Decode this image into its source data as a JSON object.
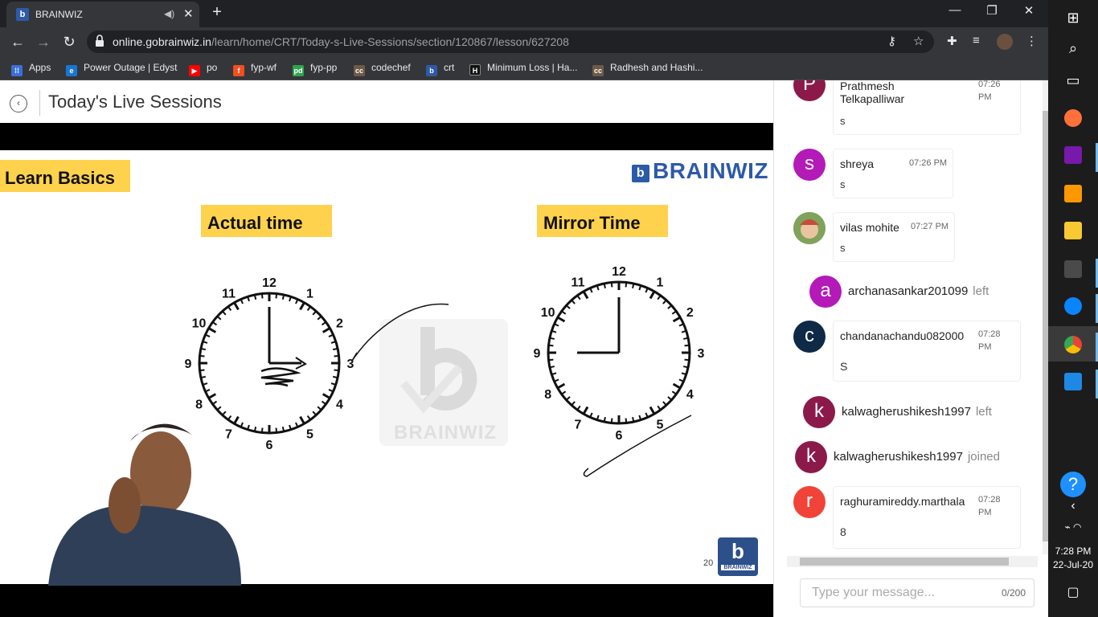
{
  "browser": {
    "tab_title": "BRAINWIZ",
    "url_domain": "online.gobrainwiz.in",
    "url_path": "/learn/home/CRT/Today-s-Live-Sessions/section/120867/lesson/627208",
    "bookmarks": [
      {
        "label": "Apps",
        "icon": "apps-grid-icon",
        "color": "#e8eaed"
      },
      {
        "label": "Power Outage | Edyst",
        "icon": "edyst-icon",
        "color": "#1976d2"
      },
      {
        "label": "po",
        "icon": "youtube-icon",
        "color": "#ff0000"
      },
      {
        "label": "fyp-wf",
        "icon": "figma-icon",
        "color": "#f24e1e"
      },
      {
        "label": "fyp-pp",
        "icon": "pd-icon",
        "color": "#2ea44f"
      },
      {
        "label": "codechef",
        "icon": "cc-icon",
        "color": "#6f5a48"
      },
      {
        "label": "crt",
        "icon": "brainwiz-icon",
        "color": "#2d5aa8"
      },
      {
        "label": "Minimum Loss | Ha...",
        "icon": "hackerrank-icon",
        "color": "#111111"
      },
      {
        "label": "Radhesh and Hashi...",
        "icon": "cc-icon",
        "color": "#6f5a48"
      }
    ]
  },
  "page": {
    "title": "Today's Live Sessions"
  },
  "slide": {
    "tag": "Learn Basics",
    "actual_label": "Actual time",
    "mirror_label": "Mirror Time",
    "brand": "BRAINWIZ",
    "watermark": "BRAINWIZ",
    "page_number": "20",
    "clock_numbers": [
      "12",
      "1",
      "2",
      "3",
      "4",
      "5",
      "6",
      "7",
      "8",
      "9",
      "10",
      "11"
    ],
    "corner_logo_text": "BRAINWIZ"
  },
  "chat": {
    "messages": [
      {
        "kind": "message",
        "avatar_letter": "P",
        "avatar_color": "#8b1a4a",
        "name_line1": "Prathmesh",
        "name_line2": "Telkapalliwar",
        "time_line1": "07:26",
        "time_line2": "PM",
        "text": "s"
      },
      {
        "kind": "message",
        "avatar_letter": "s",
        "avatar_color": "#b31ab8",
        "name_line1": "shreya",
        "time_line1": "07:26 PM",
        "text": "s"
      },
      {
        "kind": "message",
        "avatar_letter": "",
        "avatar_color": "#8aa060",
        "name_line1": "vilas mohite",
        "time_line1": "07:27 PM",
        "text": "s"
      },
      {
        "kind": "event",
        "avatar_letter": "a",
        "avatar_color": "#b31ab8",
        "name_line1": "archanasankar201099",
        "event": "left"
      },
      {
        "kind": "message",
        "avatar_letter": "c",
        "avatar_color": "#0e2a47",
        "name_line1": "chandanachandu082000",
        "time_line1": "07:28",
        "time_line2": "PM",
        "text": "S"
      },
      {
        "kind": "event",
        "avatar_letter": "k",
        "avatar_color": "#8b1a4a",
        "name_line1": "kalwagherushikesh1997",
        "event": "left"
      },
      {
        "kind": "event",
        "avatar_letter": "k",
        "avatar_color": "#8b1a4a",
        "name_line1": "kalwagherushikesh1997",
        "event": "joined"
      },
      {
        "kind": "message",
        "avatar_letter": "r",
        "avatar_color": "#f04438",
        "name_line1": "raghuramireddy.marthala",
        "time_line1": "07:28",
        "time_line2": "PM",
        "text": "8"
      }
    ],
    "input_placeholder": "Type your message...",
    "char_count": "0/200"
  },
  "taskbar": {
    "time": "7:28 PM",
    "date": "22-Jul-20",
    "apps": [
      {
        "icon": "windows-start-icon"
      },
      {
        "icon": "search-icon"
      },
      {
        "icon": "task-view-icon"
      },
      {
        "icon": "firefox-icon",
        "color": "#ff7139"
      },
      {
        "icon": "onenote-icon",
        "color": "#7719aa"
      },
      {
        "icon": "sublime-icon",
        "color": "#ff9800"
      },
      {
        "icon": "file-explorer-icon",
        "color": "#f8c933"
      },
      {
        "icon": "calculator-icon",
        "color": "#4a4a4a"
      },
      {
        "icon": "edge-icon",
        "color": "#0a84ff"
      },
      {
        "icon": "chrome-icon",
        "color": "#34a853"
      },
      {
        "icon": "photos-icon",
        "color": "#1e88e5"
      }
    ]
  }
}
